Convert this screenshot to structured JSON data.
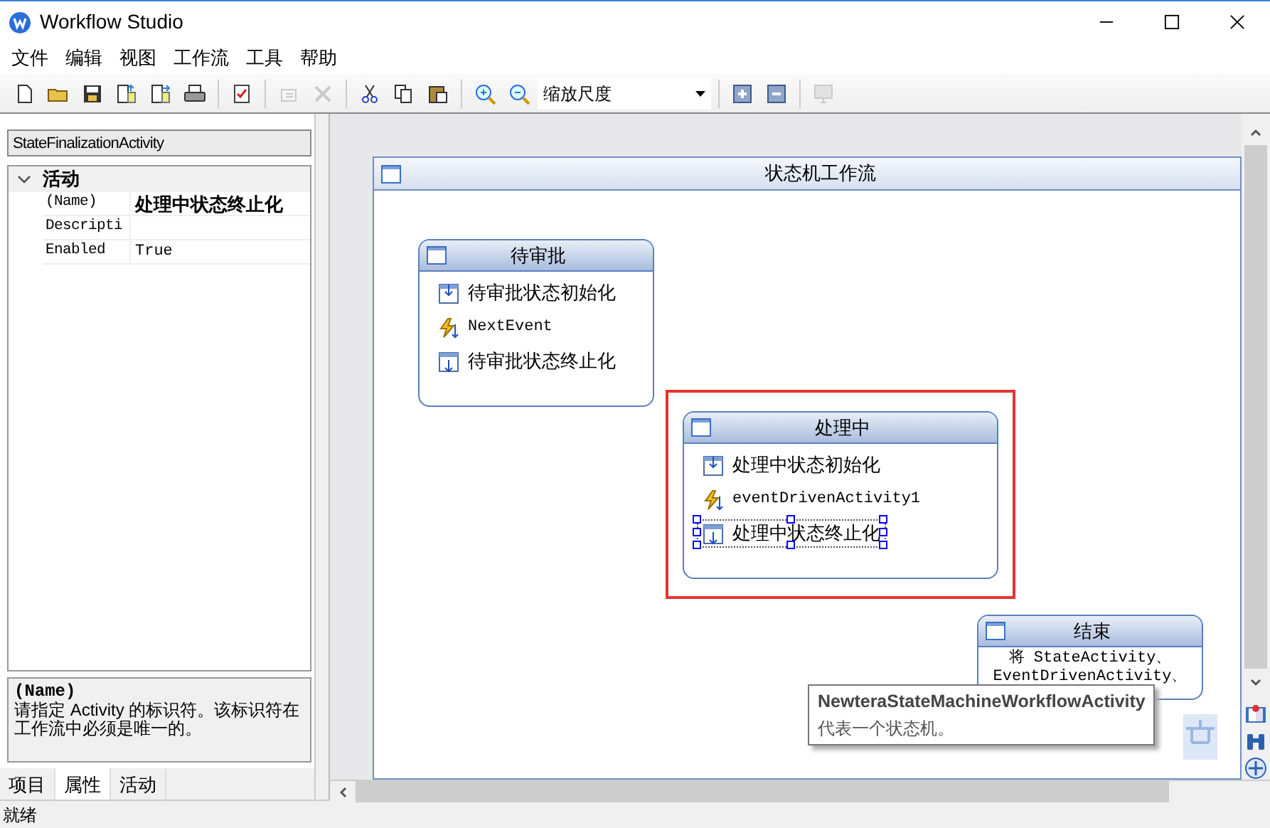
{
  "window": {
    "title": "Workflow Studio"
  },
  "menu": [
    "文件",
    "编辑",
    "视图",
    "工作流",
    "工具",
    "帮助"
  ],
  "toolbar": [
    {
      "kind": "new",
      "disabled": false
    },
    {
      "kind": "open",
      "disabled": false
    },
    {
      "kind": "save",
      "disabled": false
    },
    {
      "kind": "import",
      "disabled": false
    },
    {
      "kind": "export",
      "disabled": false
    },
    {
      "kind": "print",
      "disabled": false
    },
    {
      "kind": "separator"
    },
    {
      "kind": "validate",
      "disabled": false
    },
    {
      "kind": "separator"
    },
    {
      "kind": "add",
      "disabled": true
    },
    {
      "kind": "delete",
      "disabled": true
    },
    {
      "kind": "separator"
    },
    {
      "kind": "cut",
      "disabled": false
    },
    {
      "kind": "copy",
      "disabled": false
    },
    {
      "kind": "paste",
      "disabled": false
    },
    {
      "kind": "separator"
    },
    {
      "kind": "zoom-in",
      "disabled": false
    },
    {
      "kind": "zoom-out",
      "disabled": false
    },
    {
      "kind": "combo",
      "value": "缩放尺度"
    },
    {
      "kind": "separator"
    },
    {
      "kind": "expand",
      "disabled": false
    },
    {
      "kind": "collapse",
      "disabled": false
    },
    {
      "kind": "separator"
    },
    {
      "kind": "monitor",
      "disabled": true
    }
  ],
  "properties": {
    "object": "StateFinalizationActivity",
    "category": "活动",
    "expanded": true,
    "rows": [
      {
        "name": "(Name)",
        "value": "处理中状态终止化",
        "modified": true
      },
      {
        "name": "Descripti"
      },
      {
        "name": "Enabled",
        "value": "True",
        "modified": false
      }
    ],
    "description": {
      "title": "(Name)",
      "text": "请指定 Activity 的标识符。该标识符在工作流中必须是唯一的。"
    }
  },
  "panel_tabs": [
    {
      "label": "项目",
      "selected": false
    },
    {
      "label": "属性",
      "selected": true
    },
    {
      "label": "活动",
      "selected": false
    }
  ],
  "designer": {
    "title": "状态机工作流",
    "states": [
      {
        "title": "待审批",
        "highlighted": false,
        "activities": [
          {
            "kind": "init",
            "label": "待审批状态初始化",
            "selected": false
          },
          {
            "kind": "event",
            "label": "NextEvent",
            "selected": false
          },
          {
            "kind": "final",
            "label": "待审批状态终止化",
            "selected": false
          }
        ]
      },
      {
        "title": "处理中",
        "highlighted": true,
        "activities": [
          {
            "kind": "init",
            "label": "处理中状态初始化",
            "selected": false
          },
          {
            "kind": "event",
            "label": "eventDrivenActivity1",
            "selected": false
          },
          {
            "kind": "final",
            "label": "处理中状态终止化",
            "selected": true
          }
        ]
      },
      {
        "title": "结束",
        "highlighted": false,
        "lines": [
          "将 StateActivity、",
          "EventDrivenActivity、"
        ]
      }
    ],
    "tooltip": {
      "title": "NewteraStateMachineWorkflowActivity",
      "text": "代表一个状态机。"
    }
  },
  "status_bar": "就绪"
}
